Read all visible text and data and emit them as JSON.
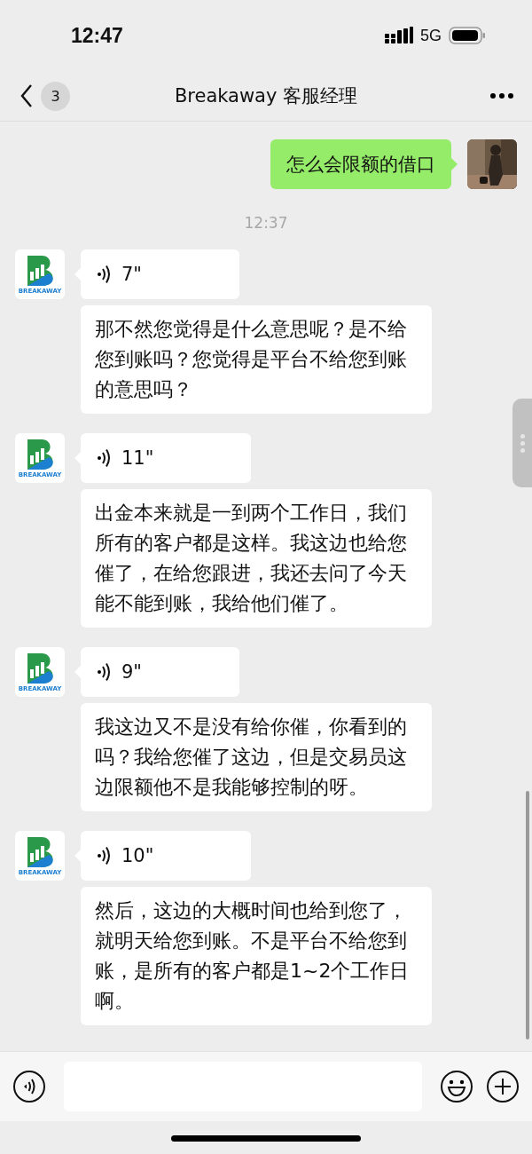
{
  "status_bar": {
    "time": "12:47",
    "network": "5G"
  },
  "nav": {
    "back_badge": "3",
    "title": "Breakaway 客服经理"
  },
  "messages": [
    {
      "kind": "sent",
      "text": "怎么会限额的借口"
    },
    {
      "kind": "time",
      "text": "12:37"
    },
    {
      "kind": "received",
      "logo_text": "BREAKAWAY",
      "voice": "7\"",
      "text": "那不然您觉得是什么意思呢？是不给您到账吗？您觉得是平台不给您到账的意思吗？"
    },
    {
      "kind": "received",
      "logo_text": "BREAKAWAY",
      "voice": "11\"",
      "text": "出金本来就是一到两个工作日，我们所有的客户都是这样。我这边也给您催了，在给您跟进，我还去问了今天能不能到账，我给他们催了。"
    },
    {
      "kind": "received",
      "logo_text": "BREAKAWAY",
      "voice": "9\"",
      "text": "我这边又不是没有给你催，你看到的吗？我给您催了这边，但是交易员这边限额他不是我能够控制的呀。"
    },
    {
      "kind": "received",
      "logo_text": "BREAKAWAY",
      "voice": "10\"",
      "text": "然后，这边的大概时间也给到您了，就明天给您到账。不是平台不给您到账，是所有的客户都是1~2个工作日啊。"
    }
  ]
}
